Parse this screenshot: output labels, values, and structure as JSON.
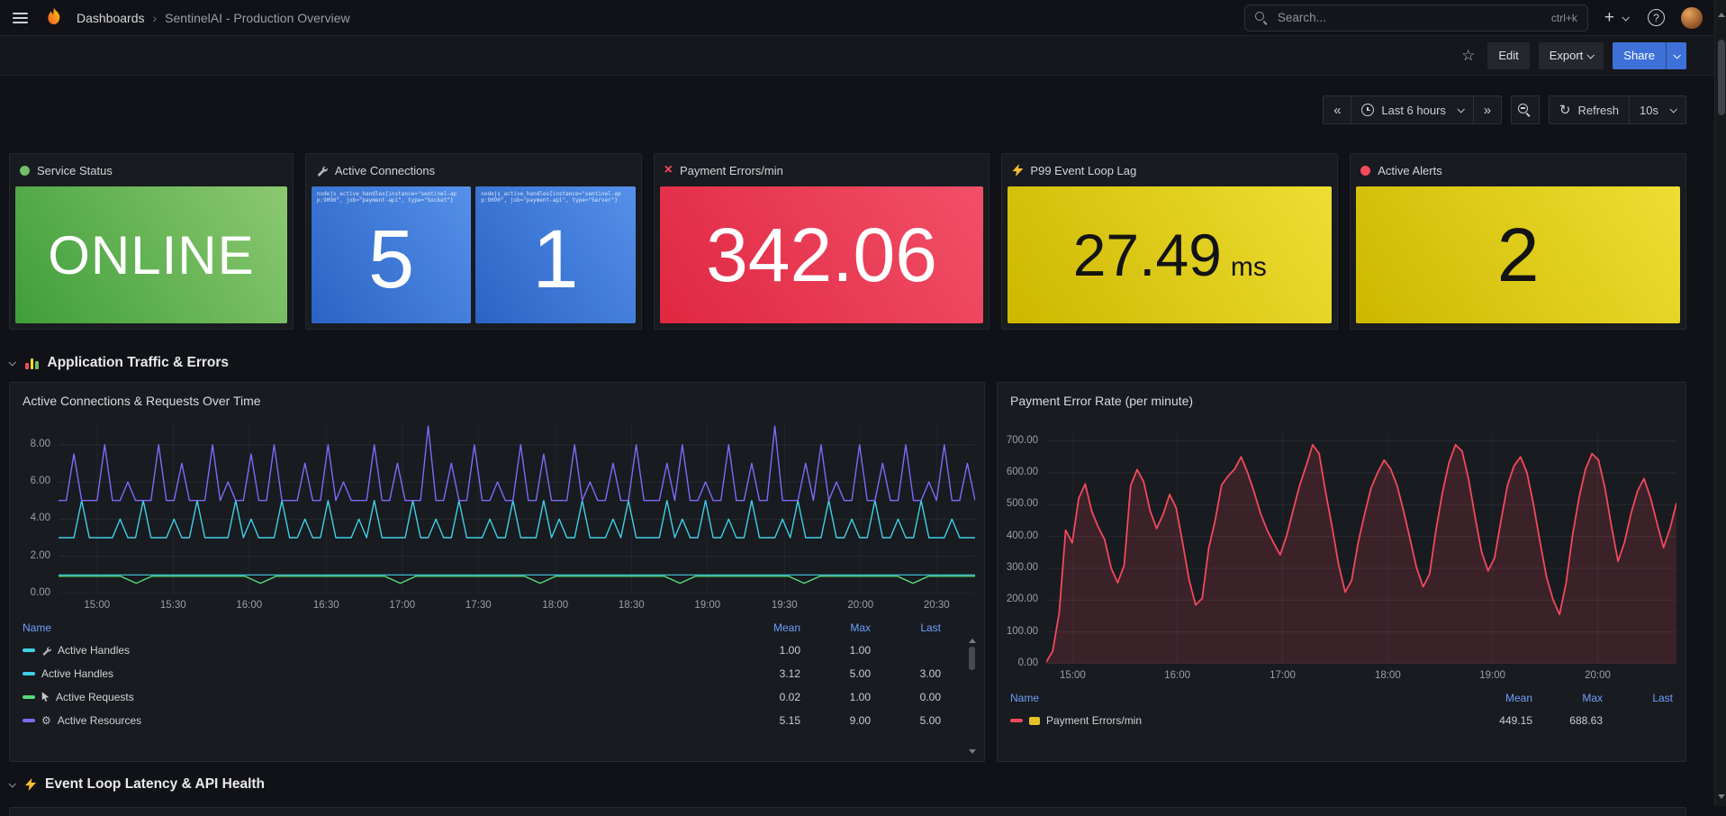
{
  "nav": {
    "breadcrumb_root": "Dashboards",
    "breadcrumb_sep": "›",
    "breadcrumb_current": "SentinelAI - Production Overview",
    "search_placeholder": "Search...",
    "search_shortcut": "ctrl+k"
  },
  "toolbar": {
    "edit": "Edit",
    "export": "Export",
    "share": "Share"
  },
  "timebar": {
    "range": "Last 6 hours",
    "refresh": "Refresh",
    "interval": "10s"
  },
  "stats": {
    "service": {
      "title": "Service Status",
      "value": "ONLINE"
    },
    "connections": {
      "title": "Active Connections",
      "cells": [
        {
          "label": "nodejs_active_handles{instance=\"sentinel-app:9090\", job=\"payment-api\", type=\"Socket\"}",
          "value": "5"
        },
        {
          "label": "nodejs_active_handles{instance=\"sentinel-app:9090\", job=\"payment-api\", type=\"Server\"}",
          "value": "1"
        }
      ]
    },
    "payment": {
      "title": "Payment Errors/min",
      "value": "342.06"
    },
    "lag": {
      "title": "P99 Event Loop Lag",
      "value": "27.49",
      "unit": "ms"
    },
    "alerts": {
      "title": "Active Alerts",
      "value": "2"
    }
  },
  "sections": {
    "s1": "Application Traffic & Errors",
    "s2": "Event Loop Latency & API Health"
  },
  "chart_data": [
    {
      "type": "line",
      "title": "Active Connections & Requests Over Time",
      "ylim": [
        0,
        9.2
      ],
      "y_ticks": [
        {
          "v": 0,
          "label": "0.00"
        },
        {
          "v": 2,
          "label": "2.00"
        },
        {
          "v": 4,
          "label": "4.00"
        },
        {
          "v": 6,
          "label": "6.00"
        },
        {
          "v": 8,
          "label": "8.00"
        }
      ],
      "x_ticks": [
        {
          "pos": 0.042,
          "label": "15:00"
        },
        {
          "pos": 0.125,
          "label": "15:30"
        },
        {
          "pos": 0.208,
          "label": "16:00"
        },
        {
          "pos": 0.292,
          "label": "16:30"
        },
        {
          "pos": 0.375,
          "label": "17:00"
        },
        {
          "pos": 0.458,
          "label": "17:30"
        },
        {
          "pos": 0.542,
          "label": "18:00"
        },
        {
          "pos": 0.625,
          "label": "18:30"
        },
        {
          "pos": 0.708,
          "label": "19:00"
        },
        {
          "pos": 0.792,
          "label": "19:30"
        },
        {
          "pos": 0.875,
          "label": "20:00"
        },
        {
          "pos": 0.958,
          "label": "20:30"
        }
      ],
      "series": [
        {
          "name": "Active Handles",
          "color": "#3fd0e8",
          "width": 1.2,
          "values": [
            1,
            1
          ]
        },
        {
          "name": "Active Requests",
          "color": "#56d97c",
          "width": 1.4,
          "values": [
            0.93,
            0.93,
            0.93,
            0.93,
            0.93,
            0.55,
            0.93,
            0.93,
            0.93,
            0.93,
            0.93,
            0.93,
            0.93,
            0.55,
            0.93,
            0.93,
            0.93,
            0.93,
            0.93,
            0.93,
            0.93,
            0.93,
            0.55,
            0.93,
            0.93,
            0.93,
            0.93,
            0.93,
            0.93,
            0.93,
            0.93,
            0.55,
            0.93,
            0.93,
            0.93,
            0.93,
            0.93,
            0.93,
            0.93,
            0.93,
            0.55,
            0.93,
            0.93,
            0.93,
            0.93,
            0.93,
            0.93,
            0.93,
            0.55,
            0.93,
            0.93,
            0.93,
            0.93,
            0.93,
            0.93,
            0.55,
            0.93,
            0.93,
            0.93,
            0.93
          ]
        },
        {
          "name": "Active Handles",
          "color": "#3fd0e8",
          "width": 1.4,
          "values": [
            3,
            3,
            3,
            5,
            3,
            3,
            3,
            3,
            4,
            3,
            3,
            5,
            3,
            3,
            3,
            4,
            3,
            3,
            5,
            3,
            3,
            3,
            3,
            5,
            3,
            4,
            3,
            3,
            3,
            5,
            3,
            3,
            4,
            3,
            3,
            5,
            3,
            3,
            3,
            4,
            3,
            5,
            3,
            3,
            3,
            3,
            5,
            3,
            3,
            4,
            3,
            3,
            5,
            3,
            3,
            3,
            4,
            3,
            3,
            5,
            3,
            3,
            3,
            5,
            3,
            4,
            3,
            3,
            5,
            3,
            3,
            3,
            4,
            3,
            5,
            3,
            3,
            3,
            3,
            5,
            3,
            4,
            3,
            3,
            5,
            3,
            3,
            4,
            3,
            3,
            5,
            3,
            3,
            3,
            4,
            3,
            5,
            3,
            3,
            3,
            5,
            3,
            3,
            4,
            3,
            3,
            5,
            3,
            3,
            4,
            3,
            3,
            5,
            3,
            3,
            3,
            4,
            3,
            3,
            3
          ]
        },
        {
          "name": "Active Resources",
          "color": "#7d6bfa",
          "width": 1.4,
          "values": [
            5,
            5,
            7.5,
            5,
            5,
            5,
            8,
            5,
            5,
            6,
            5,
            5,
            5,
            8,
            5,
            5,
            7,
            5,
            5,
            5,
            8,
            5,
            6,
            5,
            5,
            7.5,
            5,
            5,
            8,
            5,
            5,
            5,
            7,
            5,
            5,
            8,
            5,
            6,
            5,
            5,
            5,
            8,
            5,
            5,
            7,
            5,
            5,
            5,
            9,
            5,
            5,
            7,
            5,
            5,
            8,
            5,
            5,
            6,
            5,
            5,
            8,
            5,
            5,
            7.5,
            5,
            5,
            5,
            8,
            5,
            6,
            5,
            5,
            7,
            5,
            5,
            8,
            5,
            5,
            5,
            7,
            5,
            8,
            5,
            5,
            6,
            5,
            5,
            8,
            5,
            5,
            7,
            5,
            5,
            9,
            5,
            5,
            5,
            7,
            5,
            8,
            5,
            6,
            5,
            5,
            8,
            5,
            5,
            7,
            5,
            5,
            8,
            5,
            5,
            6,
            5,
            8,
            5,
            5,
            7,
            5
          ]
        }
      ],
      "legend": {
        "columns": [
          "Name",
          "Mean",
          "Max",
          "Last"
        ],
        "rows": [
          {
            "color": "#3fd0e8",
            "icon": "wrench",
            "name": "Active Handles",
            "mean": "1.00",
            "max": "1.00",
            "last": ""
          },
          {
            "color": "#3fd0e8",
            "icon": "",
            "name": "Active Handles",
            "mean": "3.12",
            "max": "5.00",
            "last": "3.00"
          },
          {
            "color": "#56d97c",
            "icon": "cursor",
            "name": "Active Requests",
            "mean": "0.02",
            "max": "1.00",
            "last": "0.00"
          },
          {
            "color": "#7d6bfa",
            "icon": "gear",
            "name": "Active Resources",
            "mean": "5.15",
            "max": "9.00",
            "last": "5.00"
          }
        ]
      }
    },
    {
      "type": "line",
      "title": "Payment Error Rate (per minute)",
      "ylim": [
        0,
        730
      ],
      "y_ticks": [
        {
          "v": 0,
          "label": "0.00"
        },
        {
          "v": 100,
          "label": "100.00"
        },
        {
          "v": 200,
          "label": "200.00"
        },
        {
          "v": 300,
          "label": "300.00"
        },
        {
          "v": 400,
          "label": "400.00"
        },
        {
          "v": 500,
          "label": "500.00"
        },
        {
          "v": 600,
          "label": "600.00"
        },
        {
          "v": 700,
          "label": "700.00"
        }
      ],
      "x_ticks": [
        {
          "pos": 0.042,
          "label": "15:00"
        },
        {
          "pos": 0.208,
          "label": "16:00"
        },
        {
          "pos": 0.375,
          "label": "17:00"
        },
        {
          "pos": 0.542,
          "label": "18:00"
        },
        {
          "pos": 0.708,
          "label": "19:00"
        },
        {
          "pos": 0.875,
          "label": "20:00"
        }
      ],
      "series": [
        {
          "name": "Payment Errors/min",
          "color": "#f2495c",
          "width": 1.8,
          "fill": "rgba(242,73,92,0.16)",
          "values": [
            5,
            40,
            160,
            420,
            380,
            520,
            565,
            480,
            430,
            390,
            300,
            255,
            310,
            560,
            610,
            572,
            480,
            425,
            470,
            532,
            490,
            380,
            262,
            185,
            205,
            362,
            450,
            562,
            590,
            612,
            650,
            600,
            540,
            472,
            420,
            380,
            342,
            402,
            482,
            560,
            622,
            688,
            660,
            540,
            430,
            312,
            225,
            262,
            380,
            470,
            552,
            600,
            640,
            612,
            560,
            480,
            392,
            302,
            242,
            282,
            422,
            540,
            632,
            688,
            668,
            580,
            462,
            352,
            292,
            332,
            452,
            562,
            622,
            650,
            600,
            500,
            382,
            272,
            202,
            155,
            252,
            402,
            522,
            612,
            660,
            640,
            552,
            432,
            322,
            382,
            472,
            542,
            582,
            522,
            442,
            365,
            425,
            505
          ]
        }
      ],
      "legend": {
        "columns": [
          "Name",
          "Mean",
          "Max",
          "Last"
        ],
        "rows": [
          {
            "color": "#f2495c",
            "icon": "card",
            "name": "Payment Errors/min",
            "mean": "449.15",
            "max": "688.63",
            "last": ""
          }
        ]
      }
    }
  ]
}
